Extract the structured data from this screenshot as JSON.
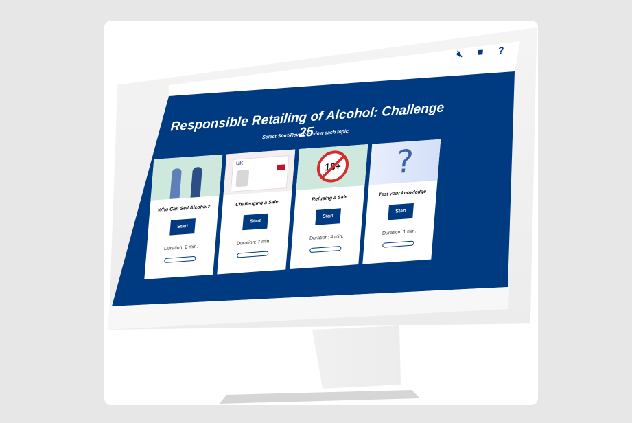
{
  "app": {
    "title": "Responsible Retailing of Alcohol: Challenge 25",
    "subtitle": "Select Start/Revisit to view each topic."
  },
  "toolbar": {
    "icons": [
      "mute-icon",
      "book-icon",
      "help-icon"
    ],
    "help_glyph": "?"
  },
  "topics": [
    {
      "title": "Who Can Sell Alcohol?",
      "start_label": "Start",
      "duration": "Duration: 2 min.",
      "progress": 0
    },
    {
      "title": "Challenging a Sale",
      "start_label": "Start",
      "duration": "Duration: 7 min.",
      "progress": 0
    },
    {
      "title": "Refusing a Sale",
      "start_label": "Start",
      "duration": "Duration: 4 min.",
      "progress": 0
    },
    {
      "title": "Test your knowledge",
      "start_label": "Start",
      "duration": "Duration: 1 min.",
      "progress": 0
    }
  ],
  "thumbs": {
    "id_card_label": "UK",
    "refuse_sign": "18+",
    "quiz_glyph": "?"
  },
  "colors": {
    "primary": "#003a80",
    "background": "#e7e7e7"
  }
}
